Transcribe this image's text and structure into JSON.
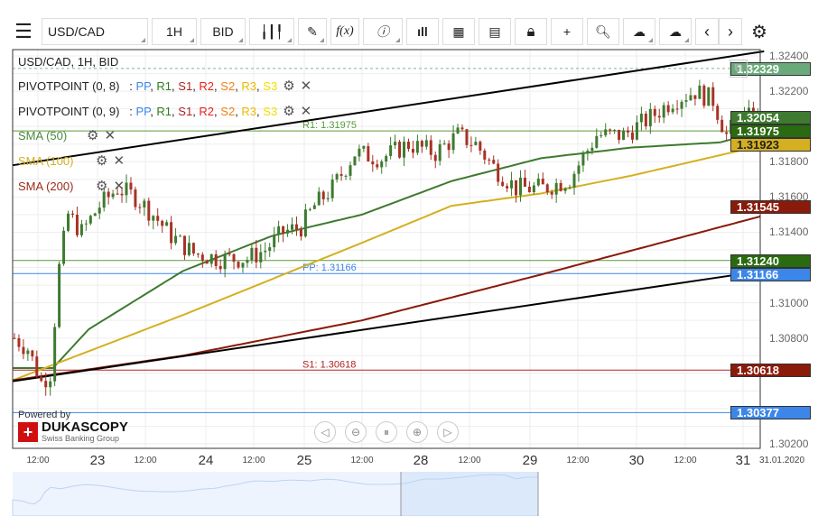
{
  "toolbar": {
    "menu_icon": "hamburger-icon",
    "symbol": "USD/CAD",
    "timeframe": "1H",
    "side": "BID",
    "fx_label": "f(x)"
  },
  "legend": {
    "title": "USD/CAD, 1H, BID",
    "pivots": [
      {
        "label": "PIVOTPOINT (0, 8)"
      },
      {
        "label": "PIVOTPOINT (0, 9)"
      }
    ],
    "pivot_levels": [
      {
        "t": "PP",
        "c": "#3b86e8"
      },
      {
        "t": "R1",
        "c": "#2e7d1e"
      },
      {
        "t": "S1",
        "c": "#b22222"
      },
      {
        "t": "R2",
        "c": "#e82020"
      },
      {
        "t": "S2",
        "c": "#f08018"
      },
      {
        "t": "R3",
        "c": "#f0b800"
      },
      {
        "t": "S3",
        "c": "#f0e000"
      }
    ],
    "smas": [
      {
        "label": "SMA (50)",
        "color": "#4a8a3a"
      },
      {
        "label": "SMA (100)",
        "color": "#d4b020"
      },
      {
        "label": "SMA (200)",
        "color": "#9a2a1a"
      }
    ]
  },
  "levels": [
    {
      "label": "R1: 1.31975",
      "value": 1.31975,
      "color": "#5a9a3a"
    },
    {
      "label": "",
      "value": 1.3124,
      "color": "#5a9a3a"
    },
    {
      "label": "PP: 1.31166",
      "value": 1.31166,
      "color": "#3b86e8"
    },
    {
      "label": "S1: 1.30618",
      "value": 1.30618,
      "color": "#b22222"
    },
    {
      "label": "",
      "value": 1.30377,
      "color": "#3b86e8"
    }
  ],
  "price_labels": [
    {
      "text": "1.32329",
      "value": 1.32329,
      "bg": "#6aaa7a"
    },
    {
      "text": "1.32054",
      "value": 1.32054,
      "bg": "#3e7a30"
    },
    {
      "text": "1.31975",
      "value": 1.31975,
      "bg": "#2a6a10"
    },
    {
      "text": "1.31923",
      "value": 1.31923,
      "bg": "#d4b020"
    },
    {
      "text": "1.31545",
      "value": 1.31545,
      "bg": "#8a1a0a"
    },
    {
      "text": "1.31240",
      "value": 1.3124,
      "bg": "#2a6a10"
    },
    {
      "text": "1.31166",
      "value": 1.31166,
      "bg": "#3b86e8"
    },
    {
      "text": "1.30618",
      "value": 1.30618,
      "bg": "#8a1a0a"
    },
    {
      "text": "1.30377",
      "value": 1.30377,
      "bg": "#3b86e8"
    }
  ],
  "y_ticks": [
    "1.32400",
    "1.32200",
    "1.31800",
    "1.31600",
    "1.31400",
    "1.31000",
    "1.30800",
    "1.30200"
  ],
  "x_ticks": [
    "12:00",
    "23",
    "12:00",
    "24",
    "12:00",
    "25",
    "12:00",
    "28",
    "12:00",
    "29",
    "12:00",
    "30",
    "12:00",
    "31",
    "31.01.2020"
  ],
  "branding": {
    "powered": "Powered by",
    "name": "DUKASCOPY",
    "sub": "Swiss Banking Group"
  },
  "chart_data": {
    "type": "candlestick",
    "title": "USD/CAD, 1H, BID",
    "ylim": [
      1.3015,
      1.3245
    ],
    "close_keypoints": [
      [
        0,
        1.308
      ],
      [
        3,
        1.3074
      ],
      [
        6,
        1.3055
      ],
      [
        8,
        1.306
      ],
      [
        10,
        1.312
      ],
      [
        12,
        1.315
      ],
      [
        15,
        1.314
      ],
      [
        19,
        1.3155
      ],
      [
        23,
        1.3165
      ],
      [
        27,
        1.316
      ],
      [
        31,
        1.315
      ],
      [
        35,
        1.3138
      ],
      [
        40,
        1.3128
      ],
      [
        46,
        1.3125
      ],
      [
        52,
        1.3125
      ],
      [
        56,
        1.313
      ],
      [
        60,
        1.314
      ],
      [
        64,
        1.3143
      ],
      [
        67,
        1.3155
      ],
      [
        71,
        1.3165
      ],
      [
        76,
        1.3185
      ],
      [
        82,
        1.3182
      ],
      [
        88,
        1.319
      ],
      [
        94,
        1.3185
      ],
      [
        99,
        1.3195
      ],
      [
        103,
        1.319
      ],
      [
        107,
        1.3177
      ],
      [
        112,
        1.3165
      ],
      [
        118,
        1.3165
      ],
      [
        124,
        1.317
      ],
      [
        130,
        1.3195
      ],
      [
        136,
        1.3195
      ],
      [
        142,
        1.3205
      ],
      [
        147,
        1.3215
      ],
      [
        152,
        1.322
      ],
      [
        156,
        1.3215
      ],
      [
        159,
        1.3195
      ],
      [
        162,
        1.3205
      ],
      [
        166,
        1.3205
      ]
    ],
    "sma50": [
      [
        0,
        1.3063
      ],
      [
        9,
        1.3063
      ],
      [
        17,
        1.3085
      ],
      [
        38,
        1.3118
      ],
      [
        58,
        1.3138
      ],
      [
        78,
        1.315
      ],
      [
        98,
        1.3169
      ],
      [
        118,
        1.3182
      ],
      [
        138,
        1.3188
      ],
      [
        158,
        1.3191
      ],
      [
        167,
        1.3197
      ]
    ],
    "sma100": [
      [
        0,
        1.3056
      ],
      [
        38,
        1.3093
      ],
      [
        78,
        1.3134
      ],
      [
        98,
        1.3155
      ],
      [
        118,
        1.3162
      ],
      [
        138,
        1.3172
      ],
      [
        167,
        1.3189
      ]
    ],
    "sma200": [
      [
        0,
        1.3056
      ],
      [
        38,
        1.307
      ],
      [
        78,
        1.309
      ],
      [
        118,
        1.3116
      ],
      [
        167,
        1.3149
      ]
    ],
    "trendlines": [
      [
        [
          0,
          1.3178
        ],
        [
          167,
          1.32426
        ]
      ],
      [
        [
          0,
          1.30555
        ],
        [
          167,
          1.31182
        ]
      ]
    ]
  }
}
